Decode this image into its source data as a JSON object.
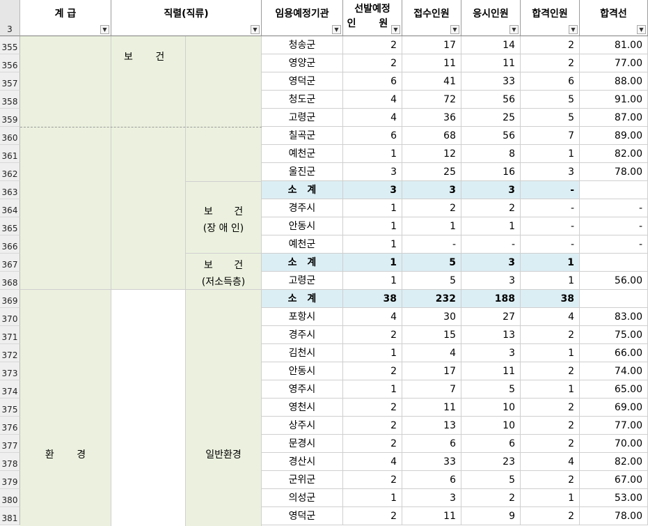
{
  "header": {
    "row_number": "3",
    "col_grade": "계 급",
    "col_series": "직렬(직류)",
    "col_agency": "임용예정기관",
    "col_quota_line1": "선발예정",
    "col_quota_line2": "인 원",
    "col_applicants": "접수인원",
    "col_examinees": "응시인원",
    "col_passers": "합격인원",
    "col_cutoff": "합격선",
    "filter_icon": "filter-dropdown-arrow-icon"
  },
  "groups": {
    "health_label": "보 건",
    "health_disabled_line1": "보 건",
    "health_disabled_line2": "(장 애 인)",
    "health_lowincome_line1": "보 건",
    "health_lowincome_line2": "(저소득층)",
    "environment_label": "환 경",
    "general_environment_label": "일반환경"
  },
  "rows": [
    {
      "num": "355",
      "agency": "청송군",
      "quota": "2",
      "applicants": "17",
      "examinees": "14",
      "passers": "2",
      "cutoff": "81.00"
    },
    {
      "num": "356",
      "agency": "영양군",
      "quota": "2",
      "applicants": "11",
      "examinees": "11",
      "passers": "2",
      "cutoff": "77.00"
    },
    {
      "num": "357",
      "agency": "영덕군",
      "quota": "6",
      "applicants": "41",
      "examinees": "33",
      "passers": "6",
      "cutoff": "88.00"
    },
    {
      "num": "358",
      "agency": "청도군",
      "quota": "4",
      "applicants": "72",
      "examinees": "56",
      "passers": "5",
      "cutoff": "91.00"
    },
    {
      "num": "359",
      "agency": "고령군",
      "quota": "4",
      "applicants": "36",
      "examinees": "25",
      "passers": "5",
      "cutoff": "87.00"
    },
    {
      "num": "360",
      "agency": "칠곡군",
      "quota": "6",
      "applicants": "68",
      "examinees": "56",
      "passers": "7",
      "cutoff": "89.00"
    },
    {
      "num": "361",
      "agency": "예천군",
      "quota": "1",
      "applicants": "12",
      "examinees": "8",
      "passers": "1",
      "cutoff": "82.00"
    },
    {
      "num": "362",
      "agency": "울진군",
      "quota": "3",
      "applicants": "25",
      "examinees": "16",
      "passers": "3",
      "cutoff": "78.00"
    },
    {
      "num": "363",
      "agency": "소 계",
      "quota": "3",
      "applicants": "3",
      "examinees": "3",
      "passers": "-",
      "cutoff": "",
      "subtotal": true
    },
    {
      "num": "364",
      "agency": "경주시",
      "quota": "1",
      "applicants": "2",
      "examinees": "2",
      "passers": "-",
      "cutoff": "-"
    },
    {
      "num": "365",
      "agency": "안동시",
      "quota": "1",
      "applicants": "1",
      "examinees": "1",
      "passers": "-",
      "cutoff": "-"
    },
    {
      "num": "366",
      "agency": "예천군",
      "quota": "1",
      "applicants": "-",
      "examinees": "-",
      "passers": "-",
      "cutoff": "-"
    },
    {
      "num": "367",
      "agency": "소 계",
      "quota": "1",
      "applicants": "5",
      "examinees": "3",
      "passers": "1",
      "cutoff": "",
      "subtotal": true
    },
    {
      "num": "368",
      "agency": "고령군",
      "quota": "1",
      "applicants": "5",
      "examinees": "3",
      "passers": "1",
      "cutoff": "56.00"
    },
    {
      "num": "369",
      "agency": "소 계",
      "quota": "38",
      "applicants": "232",
      "examinees": "188",
      "passers": "38",
      "cutoff": "",
      "subtotal": true
    },
    {
      "num": "370",
      "agency": "포항시",
      "quota": "4",
      "applicants": "30",
      "examinees": "27",
      "passers": "4",
      "cutoff": "83.00"
    },
    {
      "num": "371",
      "agency": "경주시",
      "quota": "2",
      "applicants": "15",
      "examinees": "13",
      "passers": "2",
      "cutoff": "75.00"
    },
    {
      "num": "372",
      "agency": "김천시",
      "quota": "1",
      "applicants": "4",
      "examinees": "3",
      "passers": "1",
      "cutoff": "66.00"
    },
    {
      "num": "373",
      "agency": "안동시",
      "quota": "2",
      "applicants": "17",
      "examinees": "11",
      "passers": "2",
      "cutoff": "74.00"
    },
    {
      "num": "374",
      "agency": "영주시",
      "quota": "1",
      "applicants": "7",
      "examinees": "5",
      "passers": "1",
      "cutoff": "65.00"
    },
    {
      "num": "375",
      "agency": "영천시",
      "quota": "2",
      "applicants": "11",
      "examinees": "10",
      "passers": "2",
      "cutoff": "69.00"
    },
    {
      "num": "376",
      "agency": "상주시",
      "quota": "2",
      "applicants": "13",
      "examinees": "10",
      "passers": "2",
      "cutoff": "77.00"
    },
    {
      "num": "377",
      "agency": "문경시",
      "quota": "2",
      "applicants": "6",
      "examinees": "6",
      "passers": "2",
      "cutoff": "70.00"
    },
    {
      "num": "378",
      "agency": "경산시",
      "quota": "4",
      "applicants": "33",
      "examinees": "23",
      "passers": "4",
      "cutoff": "82.00"
    },
    {
      "num": "379",
      "agency": "군위군",
      "quota": "2",
      "applicants": "6",
      "examinees": "5",
      "passers": "2",
      "cutoff": "67.00"
    },
    {
      "num": "380",
      "agency": "의성군",
      "quota": "1",
      "applicants": "3",
      "examinees": "2",
      "passers": "1",
      "cutoff": "53.00"
    },
    {
      "num": "381",
      "agency": "영덕군",
      "quota": "2",
      "applicants": "11",
      "examinees": "9",
      "passers": "2",
      "cutoff": "78.00"
    }
  ]
}
